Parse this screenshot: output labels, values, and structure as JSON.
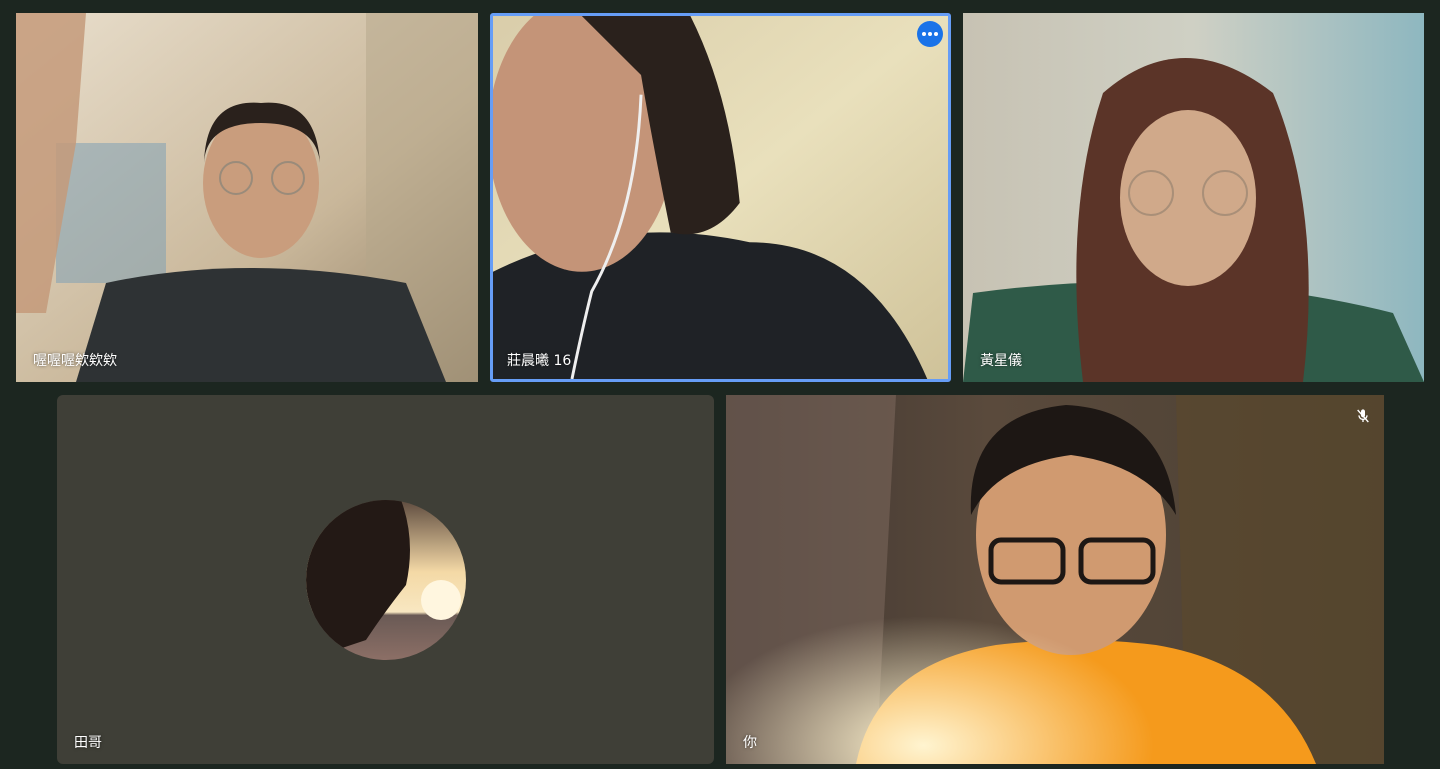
{
  "participants": [
    {
      "name": "喔喔喔欸欸欸"
    },
    {
      "name": "莊晨曦 16"
    },
    {
      "name": "黃星儀"
    },
    {
      "name": "田哥"
    },
    {
      "name": "你"
    }
  ],
  "icons": {
    "more": "more-options-icon",
    "mic": "mic-off-icon"
  },
  "colors": {
    "background": "#1c2620",
    "active_border": "#669df6",
    "more_button": "#1a73e8",
    "avatar_tile": "#3f3f37"
  }
}
